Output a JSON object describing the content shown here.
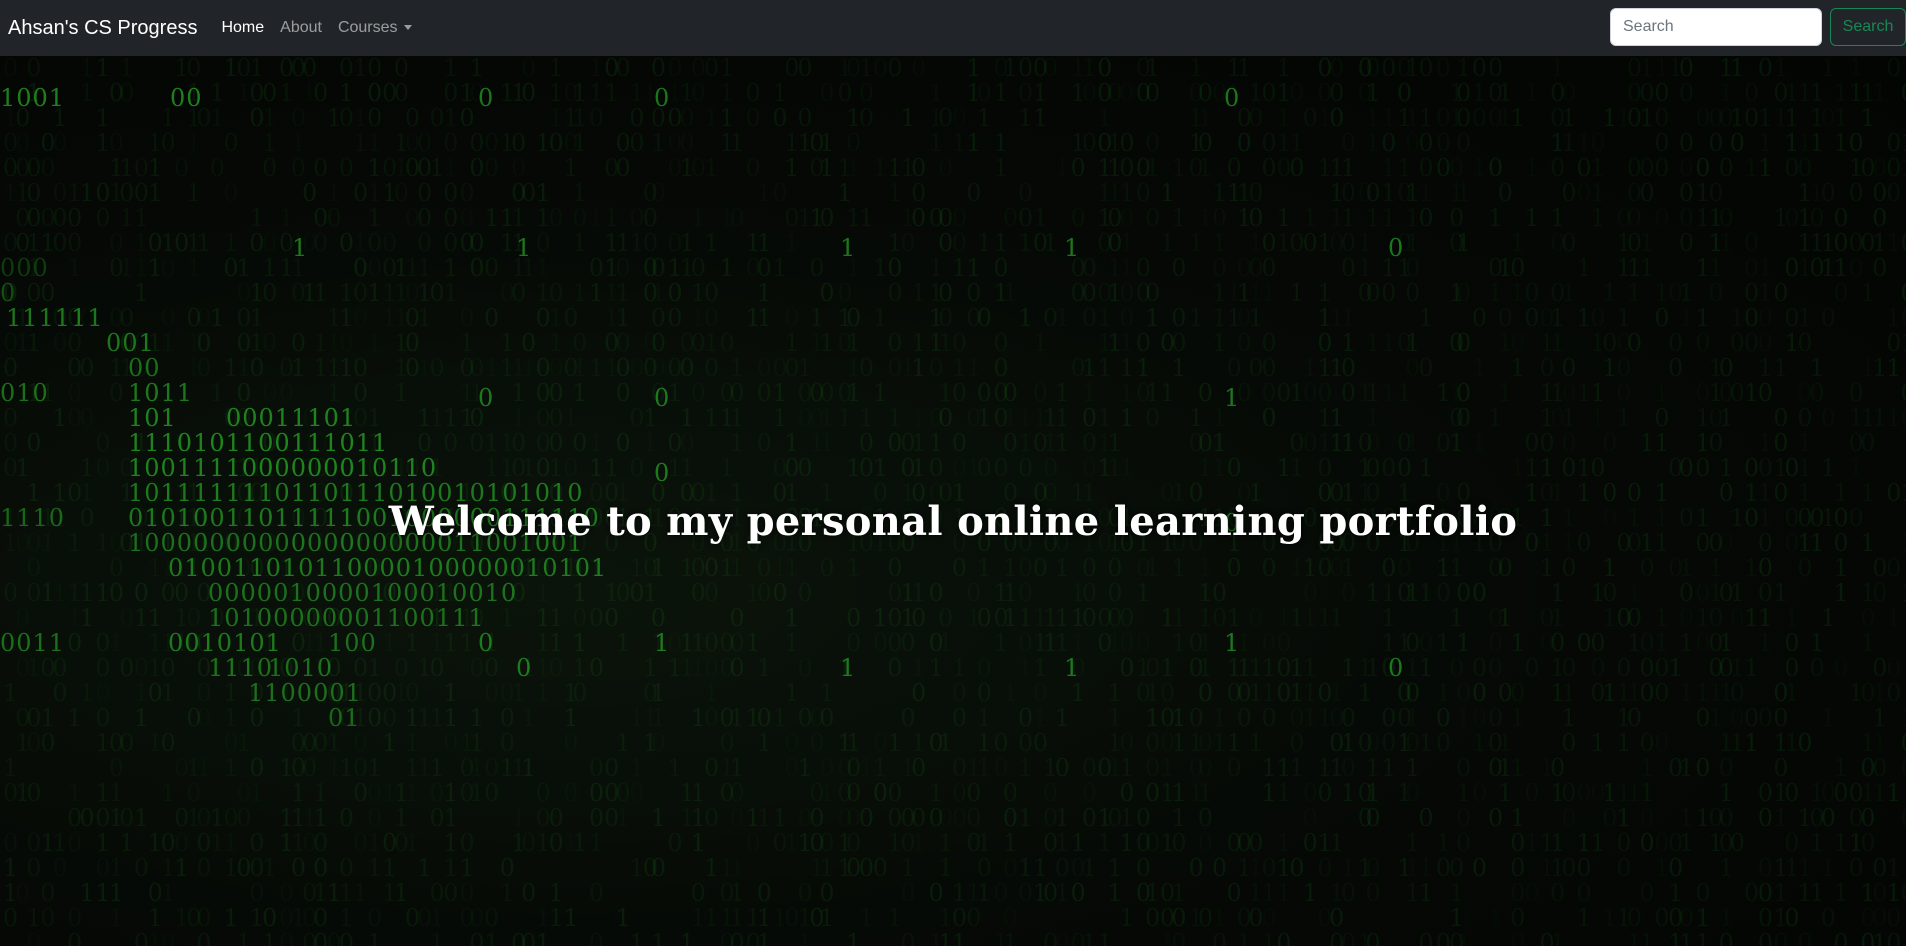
{
  "navbar": {
    "brand": "Ahsan's CS Progress",
    "links": [
      {
        "label": "Home",
        "active": true
      },
      {
        "label": "About",
        "active": false
      },
      {
        "label": "Courses",
        "active": false,
        "dropdown": true
      }
    ],
    "search": {
      "placeholder": "Search",
      "value": "",
      "button_label": "Search"
    }
  },
  "hero": {
    "title": "Welcome to my personal online learning portfolio",
    "background": "green binary digits matrix",
    "digit_color": "#2fd02f"
  },
  "colors": {
    "navbar_bg": "#212529",
    "search_button": "#198754",
    "hero_bg": "#050805"
  }
}
